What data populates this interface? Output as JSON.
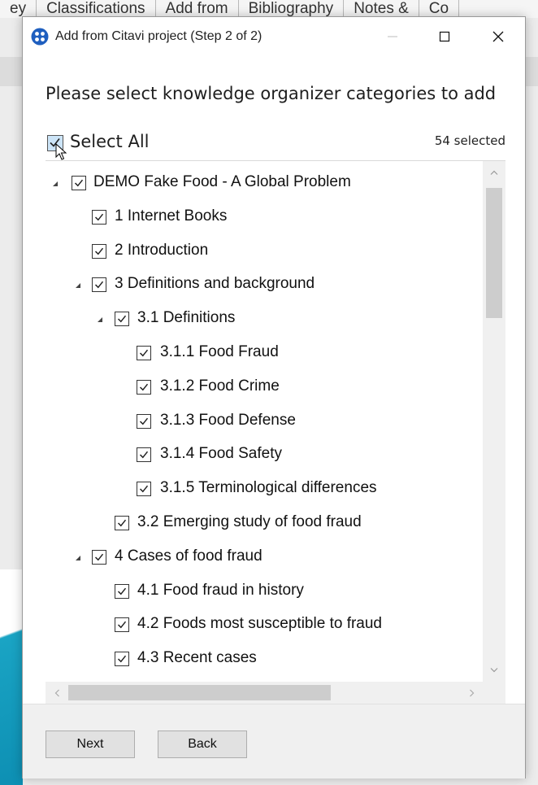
{
  "background_app": {
    "tabs": [
      "ey",
      "Classifications",
      "Add from",
      "Bibliography",
      "Notes &",
      "Co"
    ]
  },
  "dialog": {
    "title": "Add from Citavi project (Step 2 of 2)",
    "heading": "Please select knowledge organizer categories to add",
    "select_all_label": "Select All",
    "selected_count": "54 selected",
    "buttons": {
      "next": "Next",
      "back": "Back"
    }
  },
  "tree": [
    {
      "label": "DEMO Fake Food - A Global Problem",
      "level": 0,
      "expanded": true,
      "checked": true
    },
    {
      "label": "1 Internet Books",
      "level": 1,
      "expanded": null,
      "checked": true
    },
    {
      "label": "2 Introduction",
      "level": 1,
      "expanded": null,
      "checked": true
    },
    {
      "label": "3 Definitions and background",
      "level": 1,
      "expanded": true,
      "checked": true
    },
    {
      "label": "3.1 Definitions",
      "level": 2,
      "expanded": true,
      "checked": true
    },
    {
      "label": "3.1.1 Food Fraud",
      "level": 3,
      "expanded": null,
      "checked": true
    },
    {
      "label": "3.1.2 Food Crime",
      "level": 3,
      "expanded": null,
      "checked": true
    },
    {
      "label": "3.1.3 Food Defense",
      "level": 3,
      "expanded": null,
      "checked": true
    },
    {
      "label": "3.1.4 Food Safety",
      "level": 3,
      "expanded": null,
      "checked": true
    },
    {
      "label": "3.1.5 Terminological differences",
      "level": 3,
      "expanded": null,
      "checked": true
    },
    {
      "label": "3.2 Emerging study of food fraud",
      "level": 2,
      "expanded": null,
      "checked": true
    },
    {
      "label": "4 Cases of food fraud",
      "level": 1,
      "expanded": true,
      "checked": true
    },
    {
      "label": "4.1 Food fraud in history",
      "level": 2,
      "expanded": null,
      "checked": true
    },
    {
      "label": "4.2 Foods most susceptible to fraud",
      "level": 2,
      "expanded": null,
      "checked": true
    },
    {
      "label": "4.3 Recent cases",
      "level": 2,
      "expanded": null,
      "checked": true
    }
  ],
  "colors": {
    "dialog_bg": "#ffffff",
    "footer_bg": "#f0f0f0",
    "accent_teal": "#0d8fb3",
    "select_all_highlight": "#cce4f7"
  }
}
